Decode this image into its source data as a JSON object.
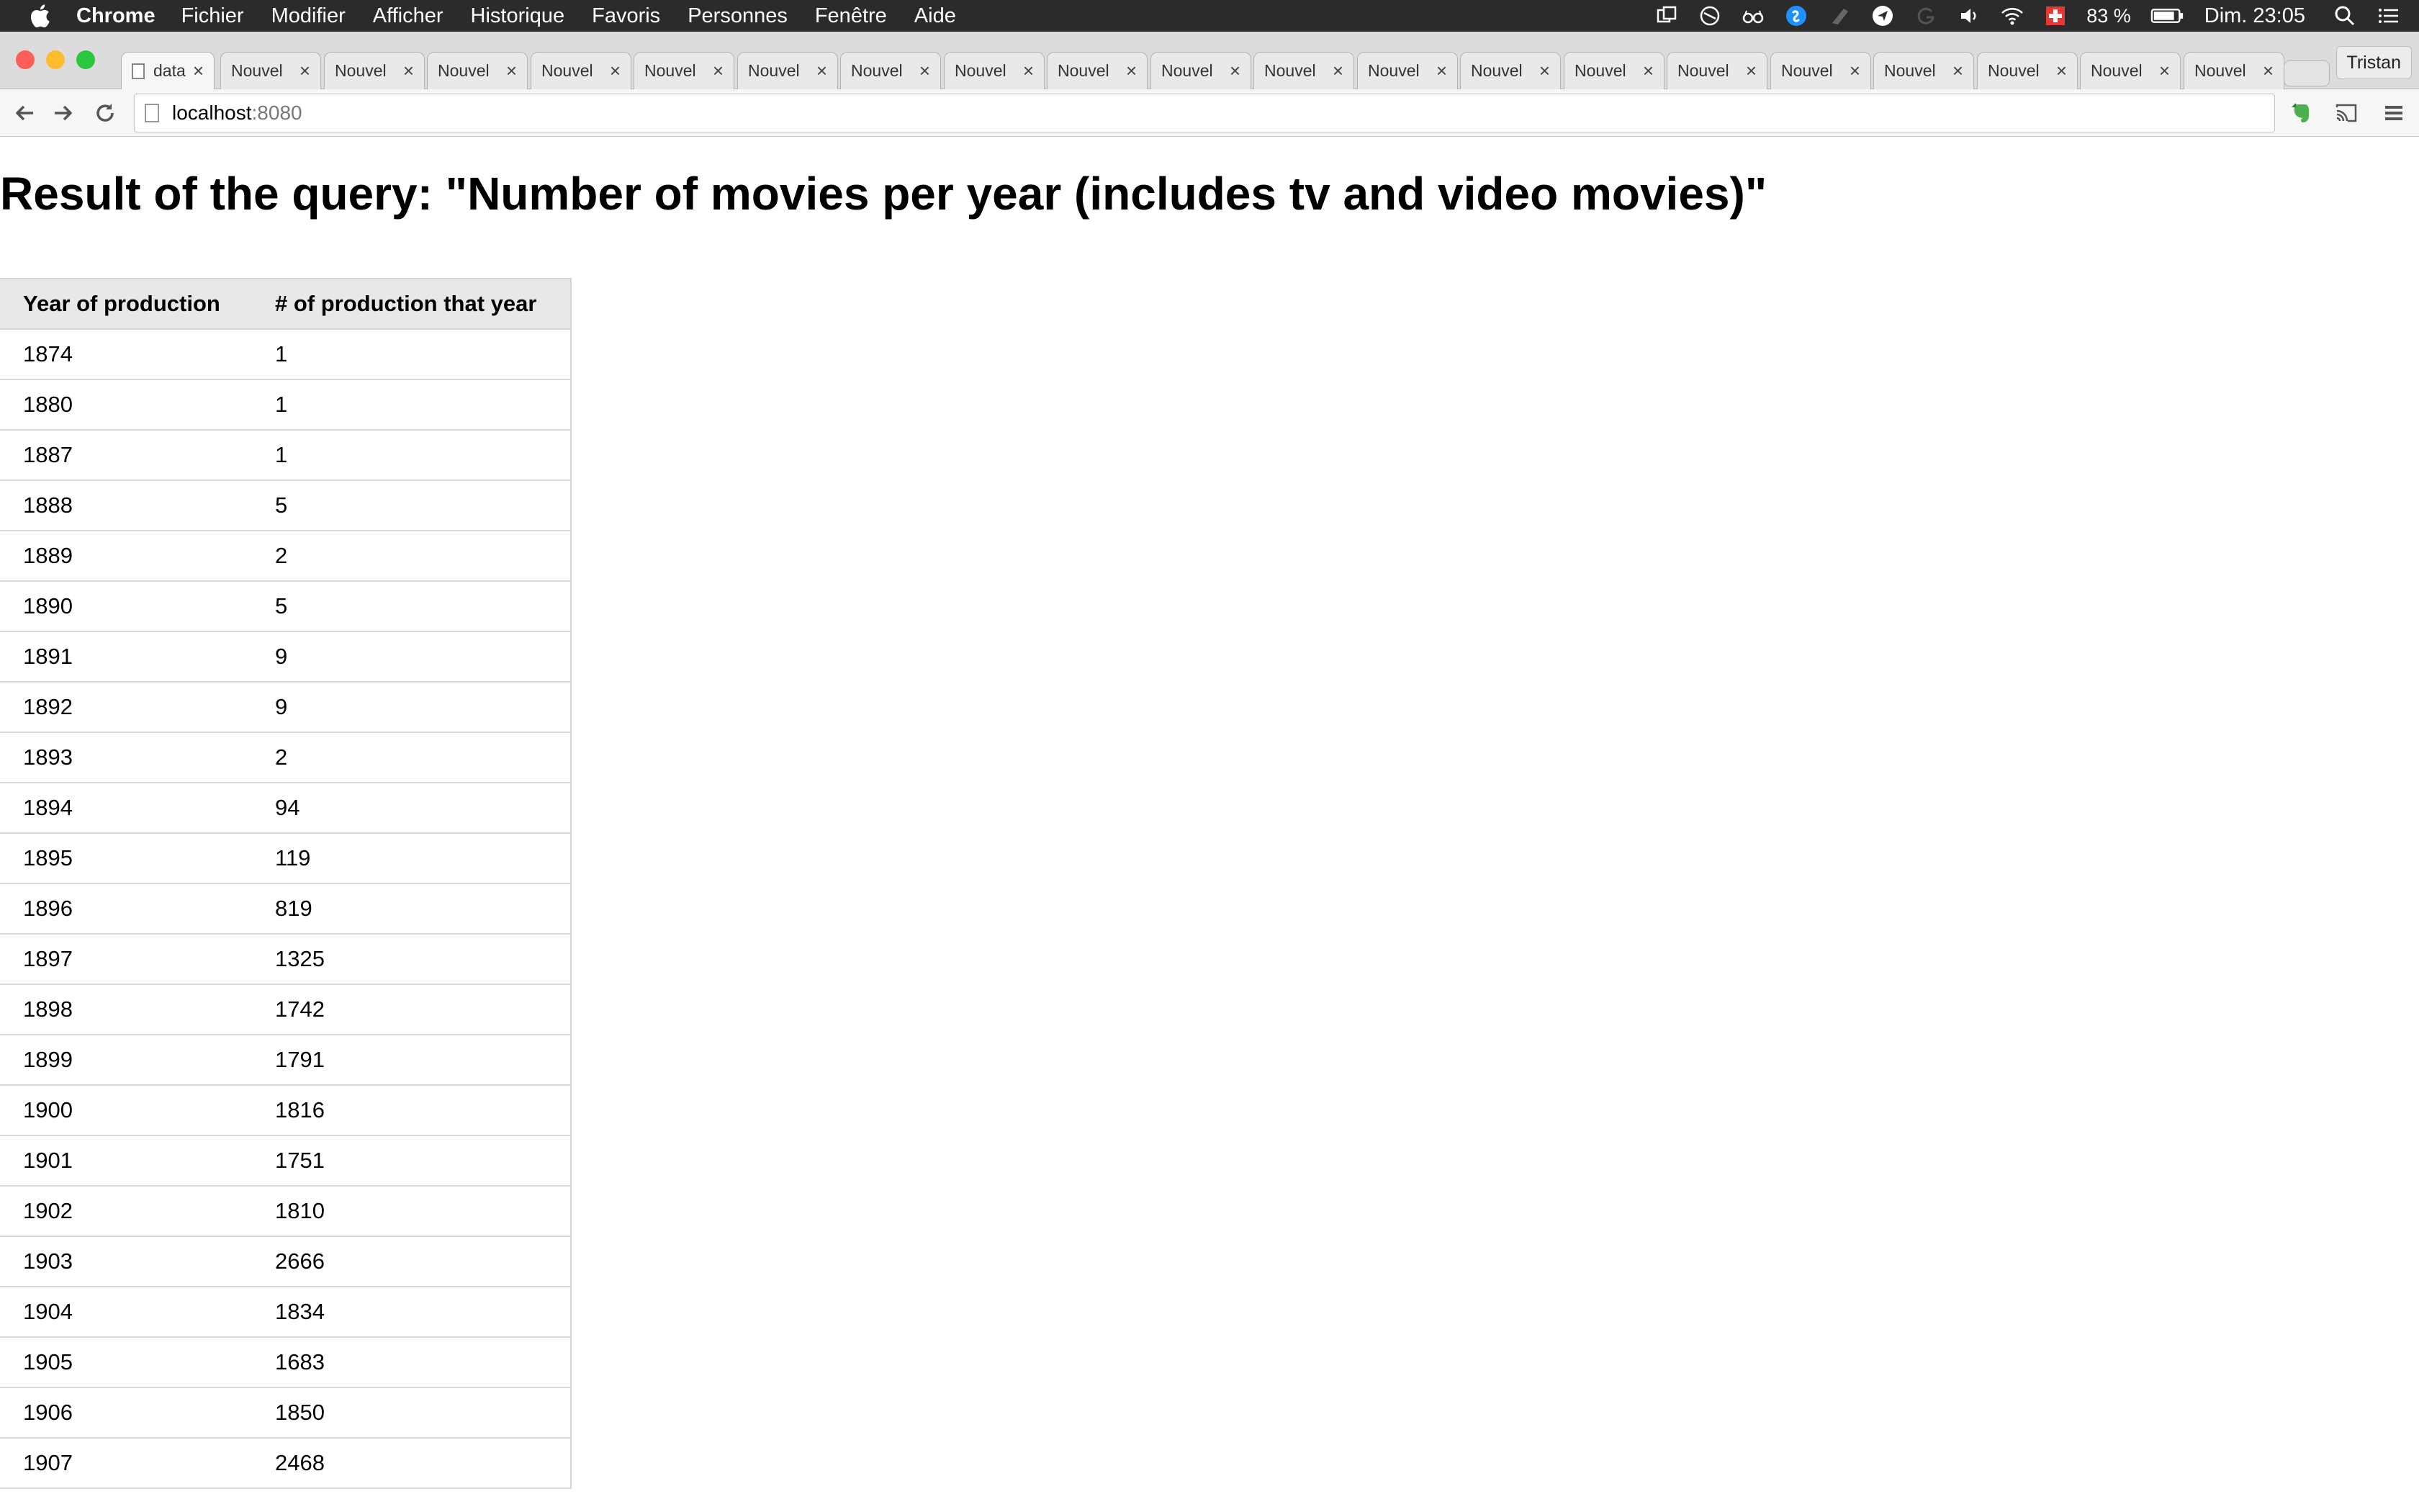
{
  "menubar": {
    "app_name": "Chrome",
    "menus": [
      "Fichier",
      "Modifier",
      "Afficher",
      "Historique",
      "Favoris",
      "Personnes",
      "Fenêtre",
      "Aide"
    ],
    "battery": "83 %",
    "clock": "Dim. 23:05",
    "status_icons": [
      "window-switch-icon",
      "do-not-disturb-icon",
      "glasses-icon",
      "shazam-icon",
      "cloud-icon",
      "location-icon",
      "grammarly-icon",
      "volume-icon",
      "wifi-icon",
      "swiss-flag-icon",
      "battery-icon",
      "spotlight-icon",
      "notification-center-icon"
    ]
  },
  "tabs": {
    "active_label": "data",
    "labels": [
      "Nouvel",
      "Nouvel",
      "Nouvel",
      "Nouvel",
      "Nouvel",
      "Nouvel",
      "Nouvel",
      "Nouvel",
      "Nouvel",
      "Nouvel",
      "Nouvel",
      "Nouvel",
      "Nouvel",
      "Nouvel",
      "Nouvel",
      "Nouvel",
      "Nouvel",
      "Nouvel",
      "Nouvel",
      "Nouvel"
    ],
    "close_glyph": "×",
    "profile": "Tristan"
  },
  "toolbar": {
    "url_host": "localhost",
    "url_port": ":8080"
  },
  "page": {
    "title": "Result of the query: \"Number of movies per year (includes tv and video movies)\"",
    "table": {
      "headers": [
        "Year of production",
        "# of production that year"
      ],
      "rows": [
        [
          "1874",
          "1"
        ],
        [
          "1880",
          "1"
        ],
        [
          "1887",
          "1"
        ],
        [
          "1888",
          "5"
        ],
        [
          "1889",
          "2"
        ],
        [
          "1890",
          "5"
        ],
        [
          "1891",
          "9"
        ],
        [
          "1892",
          "9"
        ],
        [
          "1893",
          "2"
        ],
        [
          "1894",
          "94"
        ],
        [
          "1895",
          "119"
        ],
        [
          "1896",
          "819"
        ],
        [
          "1897",
          "1325"
        ],
        [
          "1898",
          "1742"
        ],
        [
          "1899",
          "1791"
        ],
        [
          "1900",
          "1816"
        ],
        [
          "1901",
          "1751"
        ],
        [
          "1902",
          "1810"
        ],
        [
          "1903",
          "2666"
        ],
        [
          "1904",
          "1834"
        ],
        [
          "1905",
          "1683"
        ],
        [
          "1906",
          "1850"
        ],
        [
          "1907",
          "2468"
        ]
      ]
    }
  },
  "colors": {
    "menubar_bg": "#2b2b2b",
    "tabstrip_bg": "#dcdcdc",
    "table_header_bg": "#e8e8e8",
    "traffic_close": "#fc5f57",
    "traffic_min": "#fdbc2e",
    "traffic_max": "#29c840",
    "extension_green": "#4caf50"
  }
}
